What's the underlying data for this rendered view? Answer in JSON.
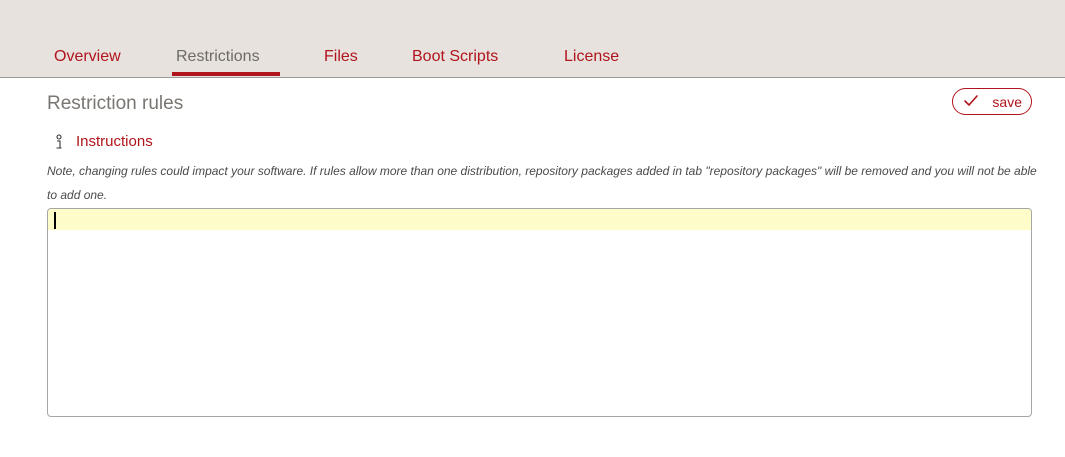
{
  "tabs": [
    {
      "label": "Overview",
      "active": false
    },
    {
      "label": "Restrictions",
      "active": true
    },
    {
      "label": "Files",
      "active": false
    },
    {
      "label": "Boot Scripts",
      "active": false
    },
    {
      "label": "License",
      "active": false
    }
  ],
  "section": {
    "title": "Restriction rules",
    "save_label": "save",
    "save_icon": "checkmark-icon"
  },
  "instructions": {
    "label": "Instructions",
    "icon": "info-icon",
    "note": "Note, changing rules could impact your software. If rules allow more than one distribution, repository packages added in tab \"repository packages\" will be removed and you will not be able to add one."
  },
  "editor": {
    "value": ""
  },
  "colors": {
    "accent": "#b0141c",
    "topbar_bg": "#e8e2de",
    "active_tab_text": "#6e6a66",
    "current_line_highlight": "#fefcc8"
  }
}
